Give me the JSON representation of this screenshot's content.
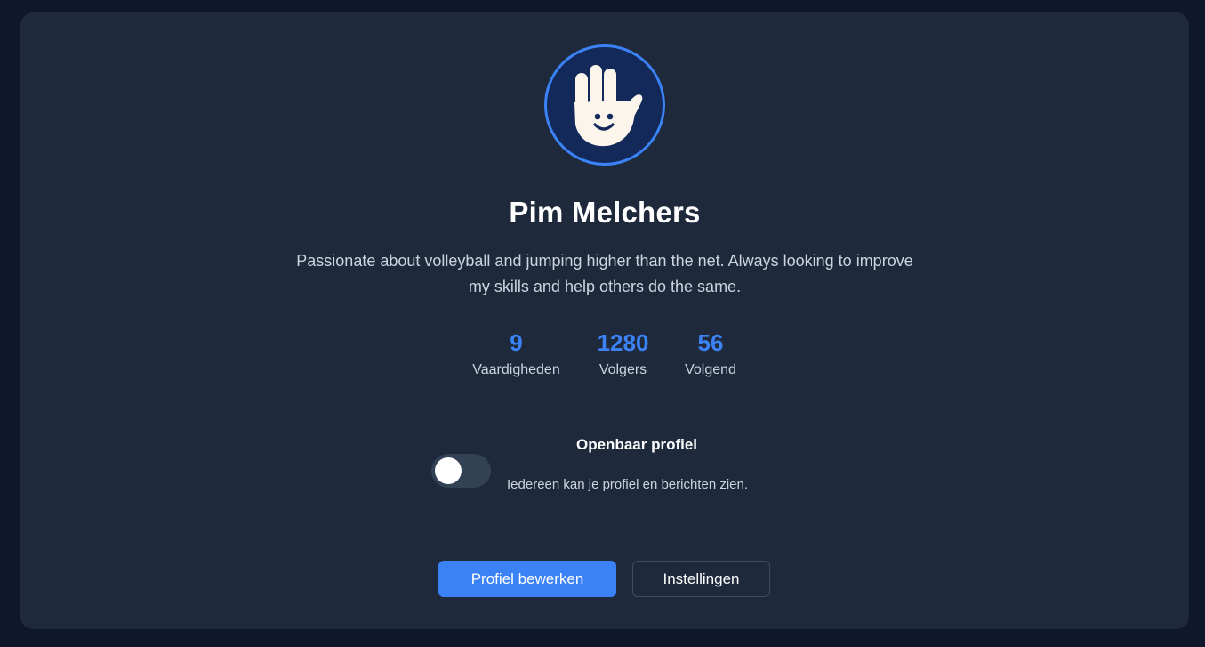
{
  "profile": {
    "avatar_icon": "waving-hand-smile-icon",
    "name": "Pim Melchers",
    "bio": "Passionate about volleyball and jumping higher than the net. Always looking to improve my skills and help others do the same."
  },
  "stats": [
    {
      "value": "9",
      "label": "Vaardigheden"
    },
    {
      "value": "1280",
      "label": "Volgers"
    },
    {
      "value": "56",
      "label": "Volgend"
    }
  ],
  "public_profile": {
    "title": "Openbaar profiel",
    "description": "Iedereen kan je profiel en berichten zien.",
    "enabled": false
  },
  "actions": {
    "edit_label": "Profiel bewerken",
    "settings_label": "Instellingen"
  },
  "colors": {
    "accent": "#3b82f6",
    "card": "#1e293b",
    "background": "#0f172a"
  }
}
